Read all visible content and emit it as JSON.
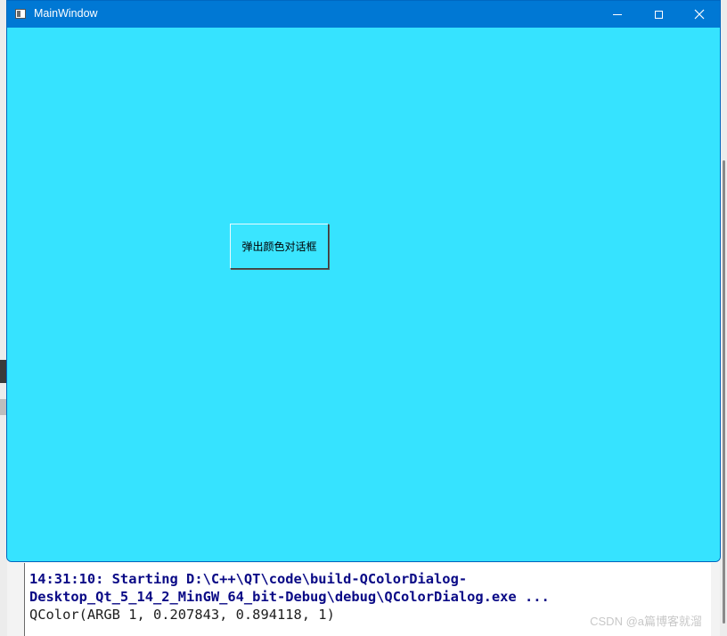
{
  "window": {
    "title": "MainWindow",
    "background_color": "#36e3ff",
    "titlebar_color": "#0078d4"
  },
  "titlebar_buttons": {
    "minimize_icon": "minimize-icon",
    "maximize_icon": "maximize-icon",
    "close_icon": "close-icon",
    "close_glyph": "✕"
  },
  "main": {
    "button_label": "弹出颜色对话框"
  },
  "output": {
    "lines": [
      "14:31:10: Starting D:\\C++\\QT\\code\\build-QColorDialog-",
      "Desktop_Qt_5_14_2_MinGW_64_bit-Debug\\debug\\QColorDialog.exe ...",
      "QColor(ARGB 1, 0.207843, 0.894118, 1)"
    ],
    "watermark": "CSDN @a篇博客就溜"
  }
}
